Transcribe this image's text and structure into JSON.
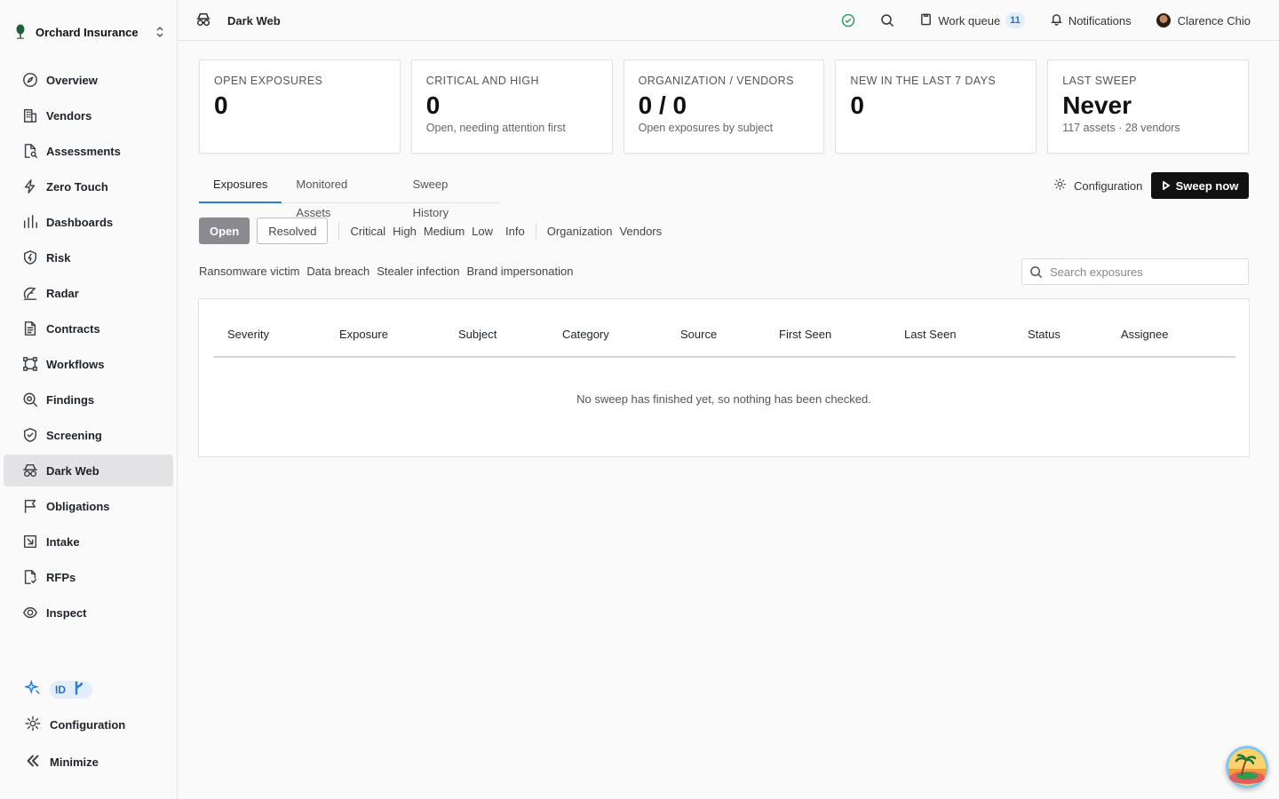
{
  "org": {
    "name": "Orchard Insurance"
  },
  "nav": [
    {
      "label": "Overview",
      "icon": "compass-icon"
    },
    {
      "label": "Vendors",
      "icon": "building-icon"
    },
    {
      "label": "Assessments",
      "icon": "file-search-icon"
    },
    {
      "label": "Zero Touch",
      "icon": "bolt-icon"
    },
    {
      "label": "Dashboards",
      "icon": "bar-chart-icon"
    },
    {
      "label": "Risk",
      "icon": "shield-bolt-icon"
    },
    {
      "label": "Radar",
      "icon": "radar-icon"
    },
    {
      "label": "Contracts",
      "icon": "document-icon"
    },
    {
      "label": "Workflows",
      "icon": "workflow-icon"
    },
    {
      "label": "Findings",
      "icon": "magnifier-icon"
    },
    {
      "label": "Screening",
      "icon": "shield-check-icon"
    },
    {
      "label": "Dark Web",
      "icon": "incognito-icon",
      "active": true
    },
    {
      "label": "Obligations",
      "icon": "flag-icon"
    },
    {
      "label": "Intake",
      "icon": "intake-icon"
    },
    {
      "label": "RFPs",
      "icon": "file-check-icon"
    },
    {
      "label": "Inspect",
      "icon": "eye-icon"
    }
  ],
  "sidebar_bottom": {
    "id_label": "ID",
    "configuration": "Configuration",
    "minimize": "Minimize"
  },
  "topbar": {
    "page_title": "Dark Web",
    "work_queue": "Work queue",
    "work_queue_count": "11",
    "notifications": "Notifications",
    "user": "Clarence Chio"
  },
  "cards": [
    {
      "label": "OPEN EXPOSURES",
      "value": "0",
      "sub": ""
    },
    {
      "label": "CRITICAL AND HIGH",
      "value": "0",
      "sub": "Open, needing attention first"
    },
    {
      "label": "ORGANIZATION / VENDORS",
      "value": "0 / 0",
      "sub": "Open exposures by subject"
    },
    {
      "label": "NEW IN THE LAST 7 DAYS",
      "value": "0",
      "sub": ""
    },
    {
      "label": "LAST SWEEP",
      "value": "Never",
      "sub": "117 assets · 28 vendors"
    }
  ],
  "tabs": [
    "Exposures",
    "Monitored Assets",
    "Sweep History"
  ],
  "actions": {
    "configuration": "Configuration",
    "sweep_now": "Sweep now"
  },
  "filters": {
    "status": [
      "Open",
      "Resolved"
    ],
    "severity": [
      "Critical",
      "High",
      "Medium",
      "Low",
      "Info"
    ],
    "subject": [
      "Organization",
      "Vendors"
    ],
    "categories": [
      "Ransomware victim",
      "Data breach",
      "Stealer infection",
      "Brand impersonation"
    ]
  },
  "search": {
    "placeholder": "Search exposures",
    "value": ""
  },
  "table": {
    "columns": [
      "Severity",
      "Exposure",
      "Subject",
      "Category",
      "Source",
      "First Seen",
      "Last Seen",
      "Status",
      "Assignee"
    ],
    "empty_message": "No sweep has finished yet, so nothing has been checked."
  },
  "colors": {
    "accent": "#2b7bd6",
    "primary_button": "#111111",
    "active_nav": "#e3e3e6",
    "status_ok": "#2f9e5b"
  }
}
